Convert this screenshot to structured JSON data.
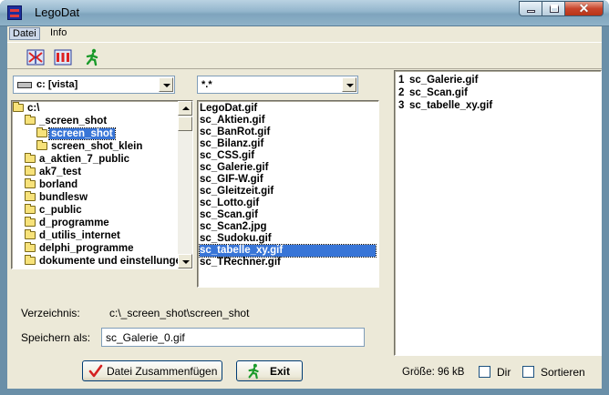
{
  "window": {
    "title": "LegoDat",
    "app_icon": "lego-app-icon",
    "controls": {
      "minimize": "minimize-icon",
      "maximize": "maximize-icon",
      "close": "close-icon",
      "close_glyph": "✕"
    }
  },
  "menu": {
    "items": [
      "Datei",
      "Info"
    ]
  },
  "toolbar": {
    "icons": [
      "split-red-icon",
      "columns-red-icon",
      "running-man-icon"
    ]
  },
  "drive_combo": {
    "value": "c: [vista]",
    "icon": "drive-icon"
  },
  "filter_combo": {
    "value": "*.*"
  },
  "folder_tree": {
    "rows": [
      {
        "label": "c:\\",
        "indent": 0,
        "icon": "open-folder-icon",
        "selected": false
      },
      {
        "label": "_screen_shot",
        "indent": 1,
        "icon": "open-folder-icon",
        "selected": false
      },
      {
        "label": "screen_shot",
        "indent": 2,
        "icon": "open-folder-icon",
        "selected": true
      },
      {
        "label": "screen_shot_klein",
        "indent": 2,
        "icon": "folder-icon",
        "selected": false
      },
      {
        "label": "a_aktien_7_public",
        "indent": 1,
        "icon": "folder-icon",
        "selected": false
      },
      {
        "label": "ak7_test",
        "indent": 1,
        "icon": "folder-icon",
        "selected": false
      },
      {
        "label": "borland",
        "indent": 1,
        "icon": "folder-icon",
        "selected": false
      },
      {
        "label": "bundlesw",
        "indent": 1,
        "icon": "folder-icon",
        "selected": false
      },
      {
        "label": "c_public",
        "indent": 1,
        "icon": "folder-icon",
        "selected": false
      },
      {
        "label": "d_programme",
        "indent": 1,
        "icon": "folder-icon",
        "selected": false
      },
      {
        "label": "d_utilis_internet",
        "indent": 1,
        "icon": "folder-icon",
        "selected": false
      },
      {
        "label": "delphi_programme",
        "indent": 1,
        "icon": "folder-icon",
        "selected": false
      },
      {
        "label": "dokumente und einstellungen",
        "indent": 1,
        "icon": "folder-icon",
        "selected": false
      }
    ]
  },
  "file_list": {
    "items": [
      {
        "name": "LegoDat.gif",
        "selected": false
      },
      {
        "name": "sc_Aktien.gif",
        "selected": false
      },
      {
        "name": "sc_BanRot.gif",
        "selected": false
      },
      {
        "name": "sc_Bilanz.gif",
        "selected": false
      },
      {
        "name": "sc_CSS.gif",
        "selected": false
      },
      {
        "name": "sc_Galerie.gif",
        "selected": false
      },
      {
        "name": "sc_GIF-W.gif",
        "selected": false
      },
      {
        "name": "sc_Gleitzeit.gif",
        "selected": false
      },
      {
        "name": "sc_Lotto.gif",
        "selected": false
      },
      {
        "name": "sc_Scan.gif",
        "selected": false
      },
      {
        "name": "sc_Scan2.jpg",
        "selected": false
      },
      {
        "name": "sc_Sudoku.gif",
        "selected": false
      },
      {
        "name": "sc_tabelle_xy.gif",
        "selected": true
      },
      {
        "name": "sc_TRechner.gif",
        "selected": false
      }
    ]
  },
  "selected_files": {
    "items": [
      {
        "index": "1",
        "name": "sc_Galerie.gif"
      },
      {
        "index": "2",
        "name": "sc_Scan.gif"
      },
      {
        "index": "3",
        "name": "sc_tabelle_xy.gif"
      }
    ]
  },
  "directory": {
    "label": "Verzeichnis:",
    "value": "c:\\_screen_shot\\screen_shot"
  },
  "save_as": {
    "label": "Speichern als:",
    "value": "sc_Galerie_0.gif"
  },
  "buttons": {
    "merge": {
      "label": "Datei Zusammenfügen",
      "icon": "checkmark-icon"
    },
    "exit": {
      "label": "Exit",
      "icon": "running-man-icon"
    }
  },
  "status": {
    "size": "Größe: 96 kB",
    "dir_label": "Dir",
    "sort_label": "Sortieren"
  }
}
